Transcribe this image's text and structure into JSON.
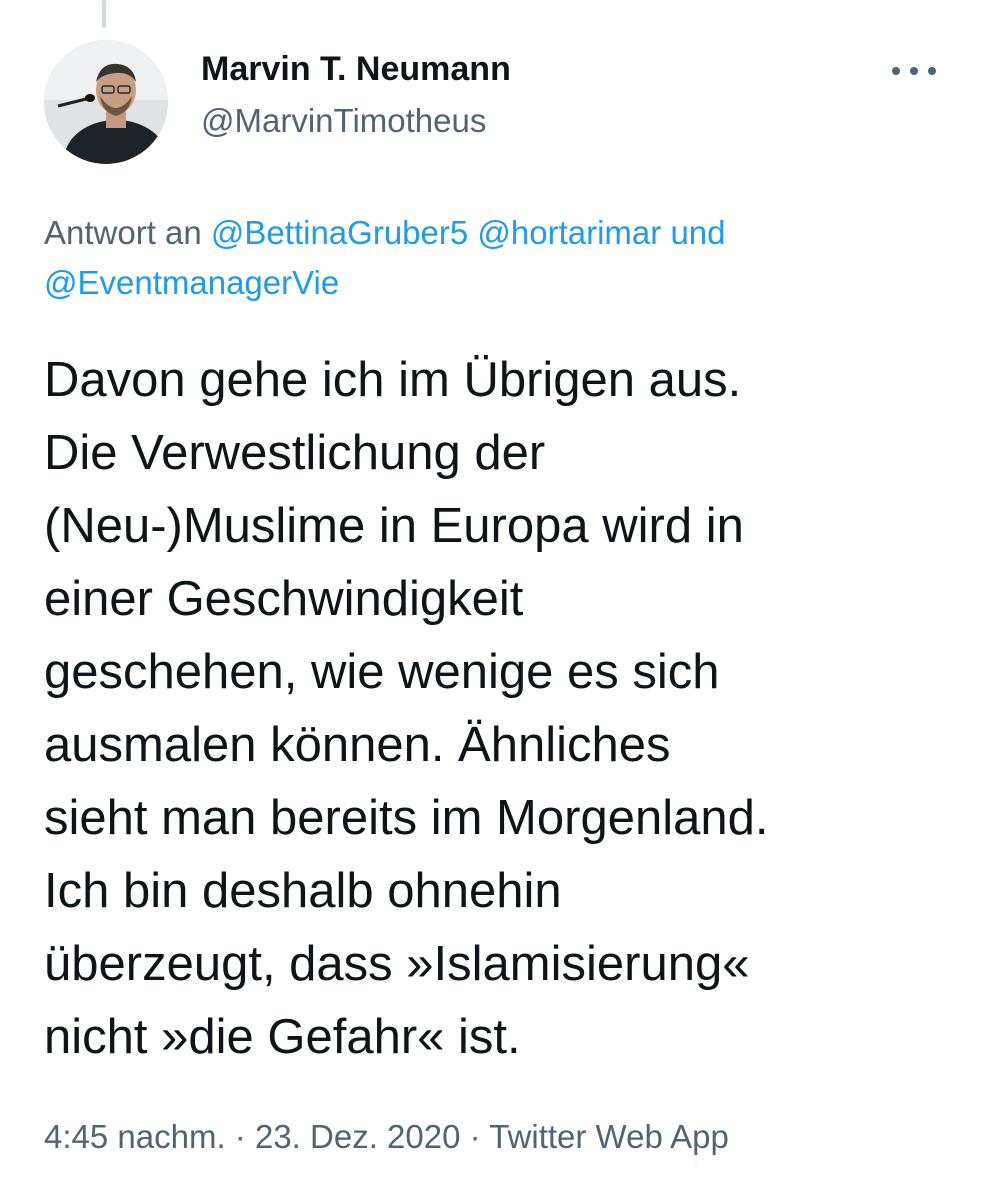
{
  "author": {
    "name": "Marvin T. Neumann",
    "handle": "@MarvinTimotheus"
  },
  "reply_to": {
    "prefix": "Antwort an",
    "mentions": [
      "@BettinaGruber5",
      "@hortarimar"
    ],
    "conjunction": "und",
    "last_mention": "@EventmanagerVie"
  },
  "tweet": {
    "lines": [
      "Davon gehe ich im Übrigen aus.",
      "Die Verwestlichung der",
      "(Neu-)Muslime in Europa wird in",
      "einer Geschwindigkeit",
      "geschehen, wie wenige es sich",
      "ausmalen können. Ähnliches",
      "sieht man bereits im Morgenland.",
      "Ich bin deshalb ohnehin",
      "überzeugt, dass »Islamisierung«",
      "nicht »die Gefahr« ist."
    ]
  },
  "meta": {
    "time": "4:45 nachm.",
    "separator": "·",
    "date": "23. Dez. 2020",
    "source": "Twitter Web App"
  },
  "icons": {
    "more": "more-horizontal-icon"
  },
  "colors": {
    "text": "#0f1419",
    "secondary": "#536471",
    "link": "#1d9bf0",
    "thread_line": "#cfd9de"
  }
}
